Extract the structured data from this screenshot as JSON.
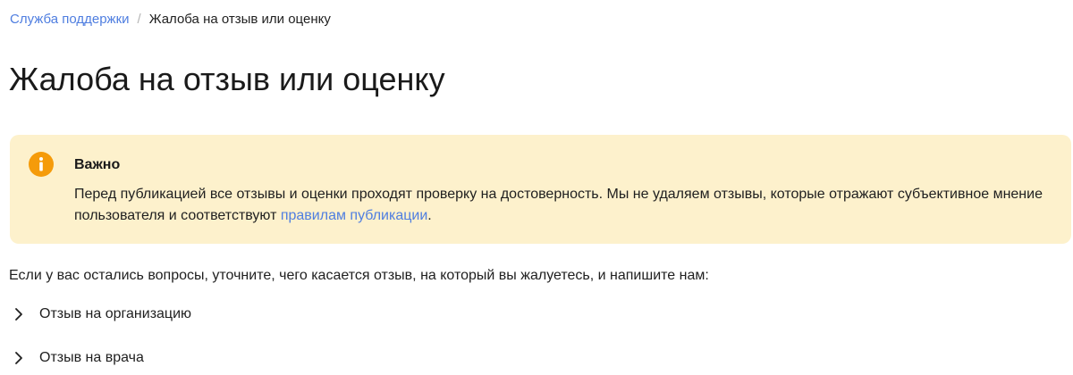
{
  "breadcrumb": {
    "parent": "Служба поддержки",
    "separator": "/",
    "current": "Жалоба на отзыв или оценку"
  },
  "page": {
    "title": "Жалоба на отзыв или оценку"
  },
  "notice": {
    "icon": "info-icon",
    "accent_color": "#f59b0a",
    "background_color": "#fdf1cc",
    "title": "Важно",
    "text_before": "Перед публикацией все отзывы и оценки проходят проверку на достоверность. Мы не удаляем отзывы, которые отражают субъективное мнение пользователя и соответствуют ",
    "link_text": "правилам публикации",
    "text_after": "."
  },
  "intro": "Если у вас остались вопросы, уточните, чего касается отзыв, на который вы жалуетесь, и напишите нам:",
  "accordion": {
    "chevron_icon": "chevron-right-icon",
    "items": [
      {
        "label": "Отзыв на организацию"
      },
      {
        "label": "Отзыв на врача"
      }
    ]
  },
  "colors": {
    "link": "#4f7ee0",
    "text": "#1f1f1f"
  }
}
